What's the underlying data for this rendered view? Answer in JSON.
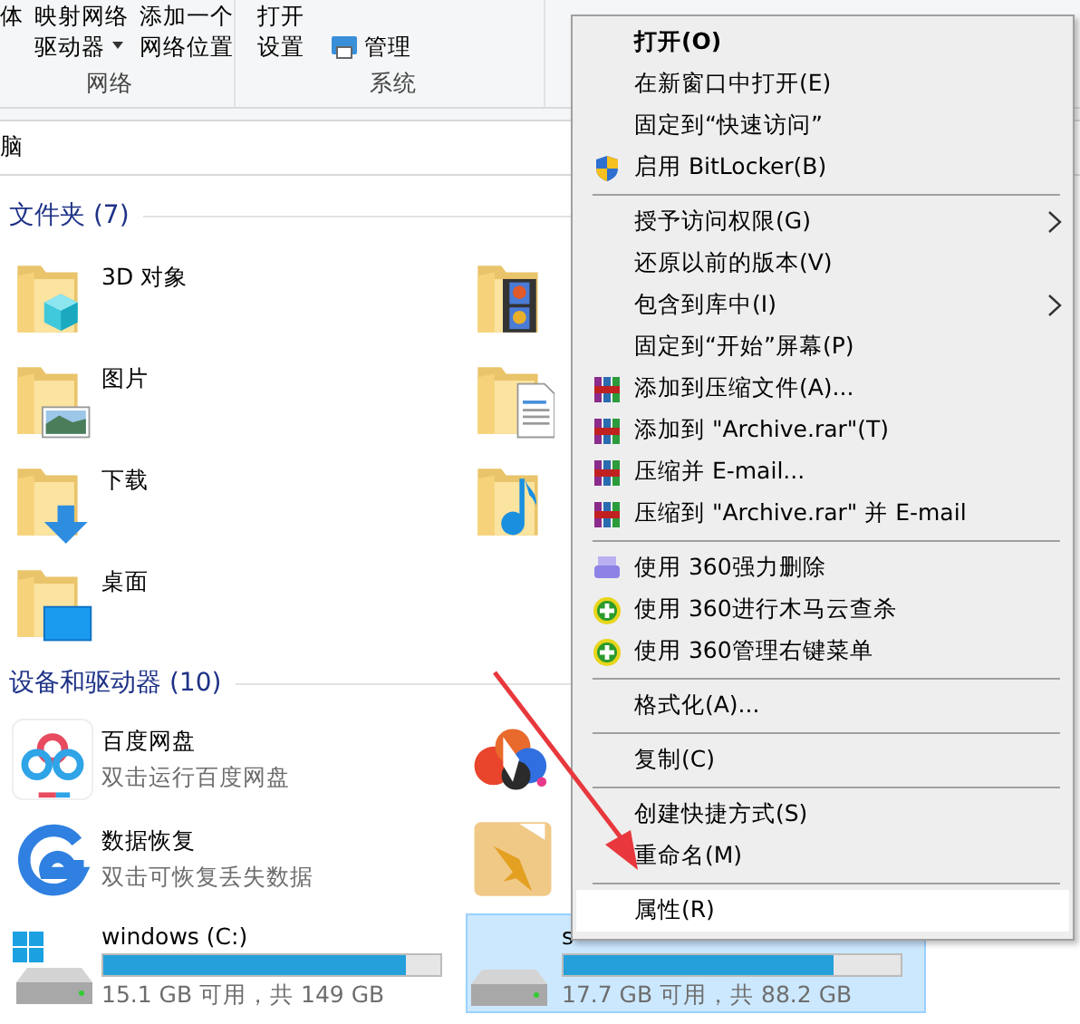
{
  "ribbon": {
    "groups": [
      {
        "label": "网络",
        "buttons": [
          {
            "kind": "text",
            "lines": [
              "体"
            ]
          },
          {
            "kind": "dropdown",
            "lines": [
              "映射网络",
              "驱动器"
            ]
          },
          {
            "kind": "text",
            "lines": [
              "添加一个",
              "网络位置"
            ]
          }
        ]
      },
      {
        "label": "系统",
        "buttons": [
          {
            "kind": "text",
            "lines": [
              "打开",
              "设置"
            ]
          },
          {
            "kind": "icon-text",
            "lines": [
              "管理"
            ]
          }
        ]
      }
    ]
  },
  "address_bar": {
    "text": "脑"
  },
  "sections": [
    {
      "title": "文件夹 (7)",
      "items": [
        {
          "kind": "folder",
          "name": "3D 对象"
        },
        {
          "kind": "folder"
        },
        {
          "kind": "folder",
          "name": "图片"
        },
        {
          "kind": "folder"
        },
        {
          "kind": "folder",
          "name": "下载"
        },
        {
          "kind": "folder"
        },
        {
          "kind": "folder",
          "name": "桌面"
        }
      ]
    },
    {
      "title": "设备和驱动器 (10)",
      "items": [
        {
          "kind": "app",
          "name": "百度网盘",
          "subtitle": "双击运行百度网盘"
        },
        {
          "kind": "app"
        },
        {
          "kind": "app",
          "name": "数据恢复",
          "subtitle": "双击可恢复丢失数据"
        },
        {
          "kind": "app"
        },
        {
          "kind": "drive",
          "name": "windows (C:)",
          "level": 0.9,
          "subtitle": "15.1 GB 可用，共 149 GB",
          "selected": false
        },
        {
          "kind": "drive",
          "name": "s",
          "level": 0.8,
          "subtitle": "17.7 GB 可用，共 88.2 GB",
          "selected": true
        }
      ]
    }
  ],
  "context_menu": {
    "items": [
      {
        "kind": "item",
        "label": "打开(O)",
        "bold": true
      },
      {
        "kind": "item",
        "label": "在新窗口中打开(E)"
      },
      {
        "kind": "item",
        "label": "固定到“快速访问”"
      },
      {
        "kind": "item",
        "label": "启用 BitLocker(B)"
      },
      {
        "kind": "separator"
      },
      {
        "kind": "item",
        "label": "授予访问权限(G)",
        "submenu": true
      },
      {
        "kind": "item",
        "label": "还原以前的版本(V)"
      },
      {
        "kind": "item",
        "label": "包含到库中(I)",
        "submenu": true
      },
      {
        "kind": "item",
        "label": "固定到“开始”屏幕(P)"
      },
      {
        "kind": "item",
        "label": "添加到压缩文件(A)..."
      },
      {
        "kind": "item",
        "label": "添加到 \"Archive.rar\"(T)"
      },
      {
        "kind": "item",
        "label": "压缩并 E-mail..."
      },
      {
        "kind": "item",
        "label": "压缩到 \"Archive.rar\" 并 E-mail"
      },
      {
        "kind": "separator"
      },
      {
        "kind": "item",
        "label": "使用 360强力删除"
      },
      {
        "kind": "item",
        "label": "使用 360进行木马云查杀"
      },
      {
        "kind": "item",
        "label": "使用 360管理右键菜单"
      },
      {
        "kind": "separator"
      },
      {
        "kind": "item",
        "label": "格式化(A)..."
      },
      {
        "kind": "separator"
      },
      {
        "kind": "item",
        "label": "复制(C)"
      },
      {
        "kind": "separator"
      },
      {
        "kind": "item",
        "label": "创建快捷方式(S)"
      },
      {
        "kind": "item",
        "label": "重命名(M)"
      },
      {
        "kind": "separator"
      },
      {
        "kind": "item",
        "label": "属性(R)",
        "selected": true
      }
    ]
  },
  "annotation": {
    "kind": "arrow"
  }
}
